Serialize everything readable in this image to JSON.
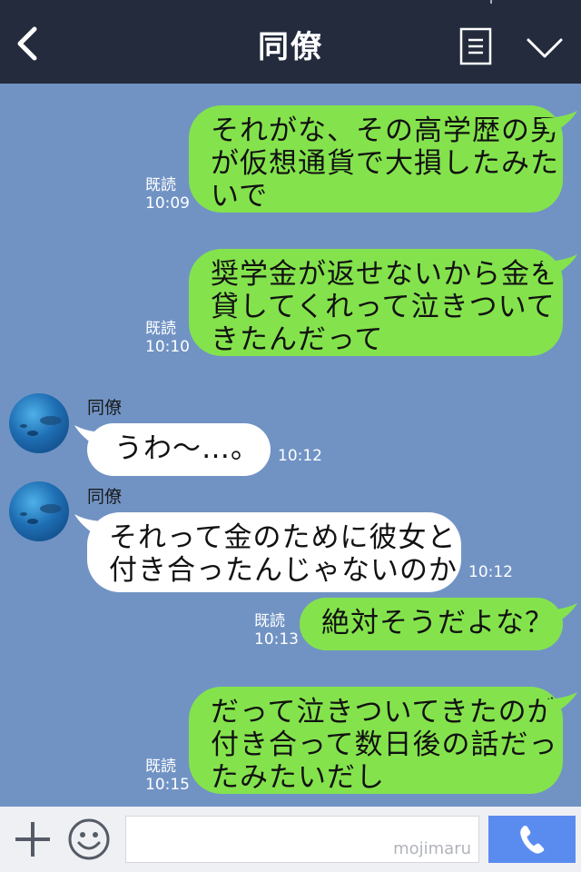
{
  "header": {
    "title": "同僚",
    "back_icon": "chevron-left-icon",
    "menu_icon": "notes-icon",
    "collapse_icon": "chevron-down-icon"
  },
  "messages": [
    {
      "side": "out",
      "lines": [
        "それがな、その高学歴の男",
        "が仮想通貨で大損したみた",
        "いで"
      ],
      "read": "既読",
      "time": "10:09"
    },
    {
      "side": "out",
      "lines": [
        "奨学金が返せないから金を",
        "貸してくれって泣きついて",
        "きたんだって"
      ],
      "read": "既読",
      "time": "10:10"
    },
    {
      "side": "in",
      "sender": "同僚",
      "lines": [
        "うわ～…。"
      ],
      "time": "10:12"
    },
    {
      "side": "in",
      "sender": "同僚",
      "lines": [
        "それって金のために彼女と",
        "付き合ったんじゃないのか"
      ],
      "time": "10:12"
    },
    {
      "side": "out",
      "lines": [
        "絶対そうだよな？"
      ],
      "read": "既読",
      "time": "10:13"
    },
    {
      "side": "out",
      "lines": [
        "だって泣きついてきたのが",
        "付き合って数日後の話だっ",
        "たみたいだし"
      ],
      "read": "既読",
      "time": "10:15"
    }
  ],
  "input_bar": {
    "watermark": "mojimaru",
    "plus_icon": "plus-icon",
    "emoji_icon": "smiley-icon",
    "call_icon": "phone-icon"
  },
  "colors": {
    "header_bg": "#232b3d",
    "chat_bg": "#7193c4",
    "outgoing_bubble": "#84e34c",
    "incoming_bubble": "#ffffff",
    "call_button": "#5a8cf0"
  }
}
